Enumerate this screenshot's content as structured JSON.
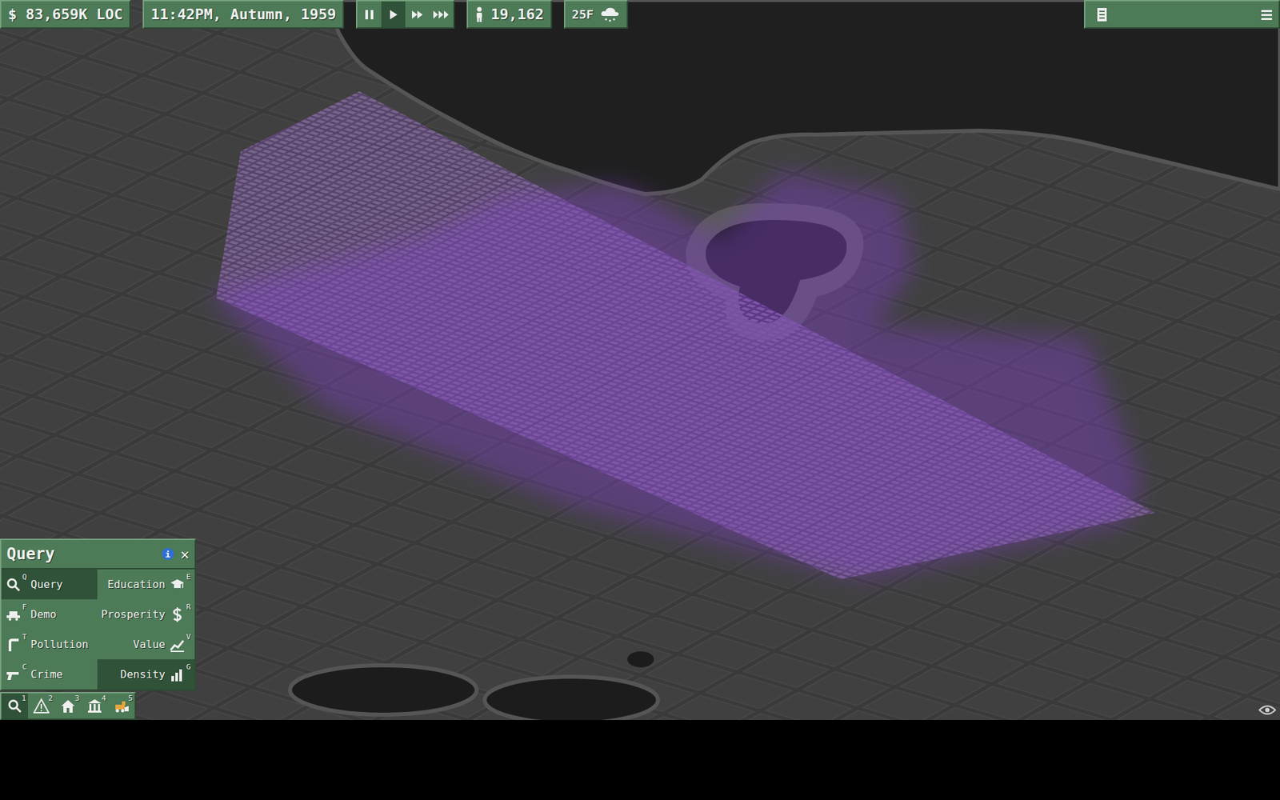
{
  "top_bar": {
    "money": "$ 83,659K LOC",
    "datetime": "11:42PM, Autumn, 1959",
    "speed_buttons": [
      {
        "kind": "pause",
        "selected": false
      },
      {
        "kind": "play",
        "selected": true
      },
      {
        "kind": "fast",
        "selected": false
      },
      {
        "kind": "fastest",
        "selected": false
      }
    ],
    "population": "19,162",
    "weather": "25F"
  },
  "query_panel": {
    "title": "Query",
    "info": "i",
    "close": "✕",
    "tools": [
      {
        "label": "Query",
        "key": "Q",
        "kind": "query",
        "selected": true
      },
      {
        "label": "Education",
        "key": "E",
        "kind": "education",
        "selected": false
      },
      {
        "label": "Demo",
        "key": "F",
        "kind": "demo",
        "selected": false
      },
      {
        "label": "Prosperity",
        "key": "R",
        "kind": "prosperity",
        "selected": false
      },
      {
        "label": "Pollution",
        "key": "T",
        "kind": "pollution",
        "selected": false
      },
      {
        "label": "Value",
        "key": "V",
        "kind": "value",
        "selected": false
      },
      {
        "label": "Crime",
        "key": "C",
        "kind": "crime",
        "selected": false
      },
      {
        "label": "Density",
        "key": "G",
        "kind": "density",
        "selected": true
      }
    ]
  },
  "toolbar": [
    {
      "key": "1",
      "kind": "query",
      "selected": true
    },
    {
      "key": "2",
      "kind": "alerts",
      "selected": false
    },
    {
      "key": "3",
      "kind": "zones",
      "selected": false
    },
    {
      "key": "4",
      "kind": "buildings",
      "selected": false
    },
    {
      "key": "5",
      "kind": "roads",
      "selected": false
    }
  ]
}
